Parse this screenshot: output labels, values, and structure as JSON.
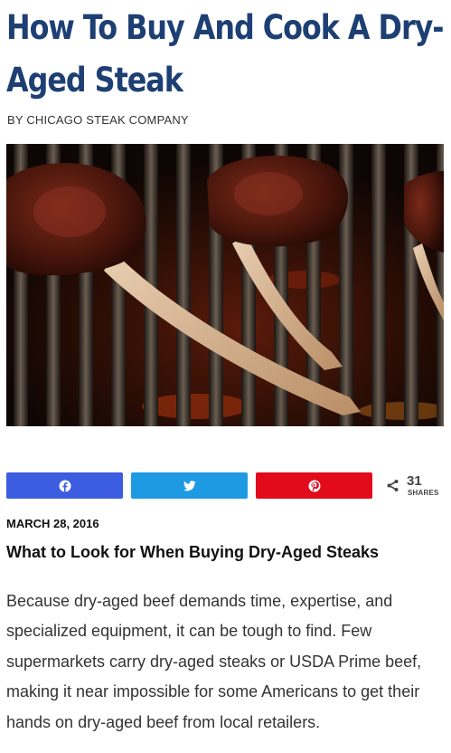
{
  "article": {
    "title": "How To Buy And Cook A Dry-Aged Steak",
    "byline": "BY CHICAGO STEAK COMPANY",
    "image_alt": "Dry-aged tomahawk steaks on a grill",
    "date": "MARCH 28, 2016",
    "subheading": "What to Look for When Buying Dry-Aged Steaks",
    "paragraph": "Because dry-aged beef demands time, expertise, and specialized equipment, it can be tough to find. Few supermarkets carry dry-aged steaks or USDA Prime beef, making it near impossible for some Americans to get their hands on dry-aged beef from local retailers."
  },
  "share": {
    "count": "31",
    "count_label": "SHARES",
    "buttons": [
      {
        "network": "facebook",
        "icon": "facebook-icon",
        "color": "#3c5de0"
      },
      {
        "network": "twitter",
        "icon": "twitter-icon",
        "color": "#1e9ae2"
      },
      {
        "network": "pinterest",
        "icon": "pinterest-icon",
        "color": "#e10b1c"
      }
    ]
  },
  "colors": {
    "title": "#1d3f73"
  }
}
